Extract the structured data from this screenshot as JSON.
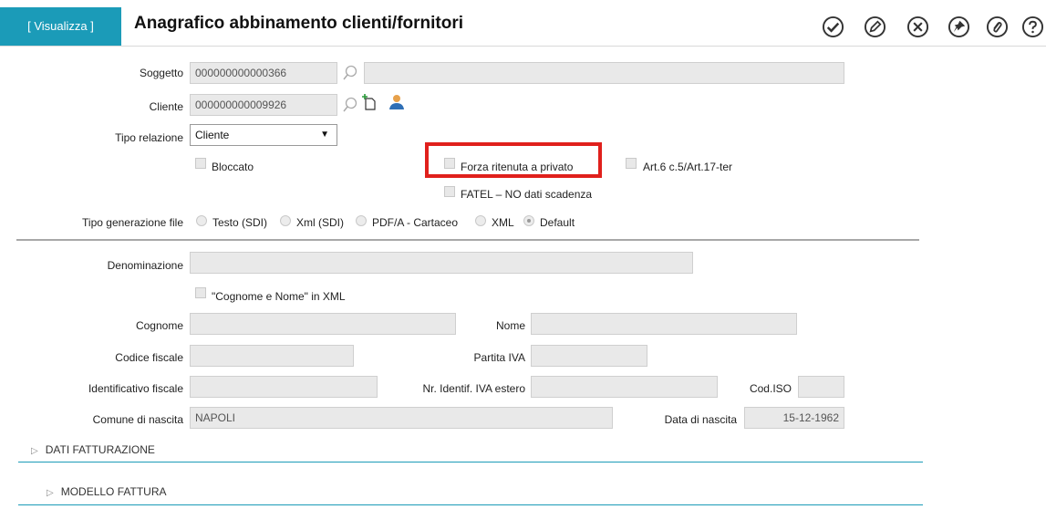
{
  "header": {
    "mode_tab": "[ Visualizza ]",
    "title": "Anagrafico abbinamento clienti/fornitori",
    "toolbar": [
      "confirm-icon",
      "edit-icon",
      "cancel-icon",
      "pin-icon",
      "attachment-icon",
      "help-icon"
    ]
  },
  "form": {
    "soggetto": {
      "label": "Soggetto",
      "value": "000000000000366",
      "description": ""
    },
    "cliente": {
      "label": "Cliente",
      "value": "000000000009926"
    },
    "tipo_relazione": {
      "label": "Tipo relazione",
      "value": "Cliente"
    },
    "checkboxes": {
      "bloccato": "Bloccato",
      "forza_ritenuta": "Forza ritenuta a privato",
      "art6": "Art.6 c.5/Art.17-ter",
      "fatel": "FATEL – NO dati scadenza"
    },
    "tipo_generazione": {
      "label": "Tipo generazione file",
      "options": [
        "Testo (SDI)",
        "Xml (SDI)",
        "PDF/A - Cartaceo",
        "XML",
        "Default"
      ],
      "selected": "Default"
    },
    "denominazione": {
      "label": "Denominazione",
      "value": ""
    },
    "cognome_nome_xml": "\"Cognome e Nome\" in XML",
    "cognome": {
      "label": "Cognome",
      "value": ""
    },
    "nome": {
      "label": "Nome",
      "value": ""
    },
    "codice_fiscale": {
      "label": "Codice fiscale",
      "value": ""
    },
    "partita_iva": {
      "label": "Partita IVA",
      "value": ""
    },
    "identificativo_fiscale": {
      "label": "Identificativo fiscale",
      "value": ""
    },
    "nr_identif_iva_estero": {
      "label": "Nr. Identif. IVA estero",
      "value": ""
    },
    "cod_iso": {
      "label": "Cod.ISO",
      "value": ""
    },
    "comune_nascita": {
      "label": "Comune di nascita",
      "value": "NAPOLI"
    },
    "data_nascita": {
      "label": "Data di nascita",
      "value": "15-12-1962"
    }
  },
  "sections": {
    "dati_fatturazione": "DATI FATTURAZIONE",
    "modello_fattura": "MODELLO FATTURA"
  },
  "colors": {
    "accent": "#1b9bb8",
    "highlight": "#e0201c"
  }
}
